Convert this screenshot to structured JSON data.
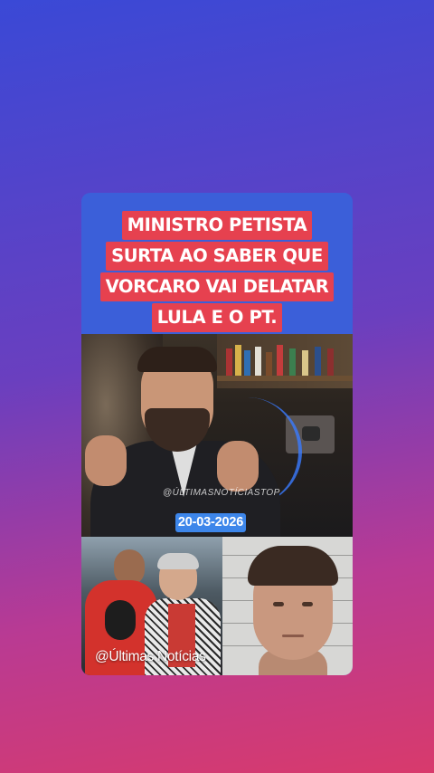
{
  "story": {
    "headline_lines": [
      "MINISTRO PETISTA",
      "SURTA AO SABER QUE",
      "VORCARO VAI DELATAR",
      "LULA E O PT."
    ],
    "video_watermark": "@ÚLTIMASNOTÍCIASTOP",
    "date": "20-03-2026",
    "photo_caption": "@Últimas Notícias"
  },
  "colors": {
    "headline_highlight": "#e6414f",
    "headline_panel": "#3b5fd9",
    "date_badge": "#3d86ea",
    "background_top": "#3a49d6",
    "background_bottom": "#d83a6c"
  }
}
